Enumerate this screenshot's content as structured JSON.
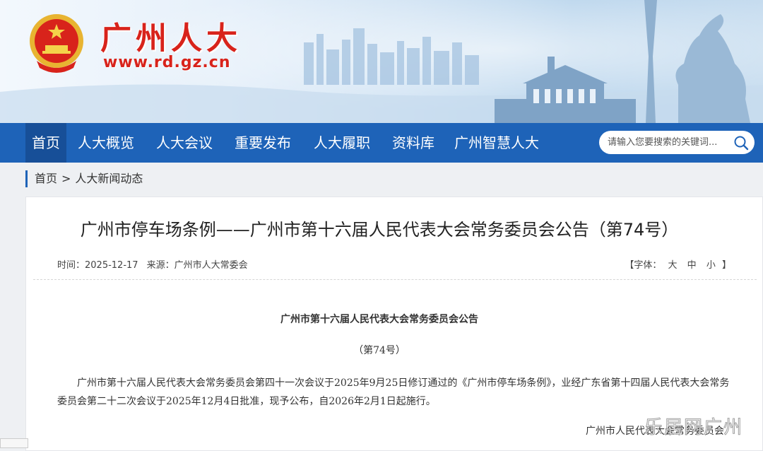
{
  "header": {
    "site_name": "广州人大",
    "site_url": "www.rd.gz.cn"
  },
  "nav": {
    "items": [
      {
        "label": "首页",
        "active": true
      },
      {
        "label": "人大概览"
      },
      {
        "label": "人大会议"
      },
      {
        "label": "重要发布"
      },
      {
        "label": "人大履职"
      },
      {
        "label": "资料库"
      },
      {
        "label": "广州智慧人大"
      }
    ],
    "search_placeholder": "请输入您要搜索的关键词...",
    "search_icon": "search-icon"
  },
  "breadcrumb": {
    "home": "首页",
    "separator": ">",
    "current": "人大新闻动态"
  },
  "article": {
    "title": "广州市停车场条例——广州市第十六届人民代表大会常务委员会公告（第74号）",
    "time_label": "时间：",
    "time_value": "2025-12-17",
    "source_label": "来源：",
    "source_value": "广州市人大常委会",
    "font_label": "【字体：",
    "font_large": "大",
    "font_medium": "中",
    "font_small": "小",
    "font_close": "】",
    "body_title": "广州市第十六届人民代表大会常务委员会公告",
    "body_number": "（第74号）",
    "body_paragraph": "广州市第十六届人民代表大会常务委员会第四十一次会议于2025年9月25日修订通过的《广州市停车场条例》，业经广东省第十四届人民代表大会常务委员会第二十二次会议于2025年12月4日批准，现予公布，自2026年2月1日起施行。",
    "signature": "广州市人民代表大会常务委员会"
  },
  "watermark": "乐居网广州",
  "colors": {
    "brand_red": "#d8231b",
    "nav_blue": "#1e63b8",
    "nav_active": "#174f98"
  }
}
